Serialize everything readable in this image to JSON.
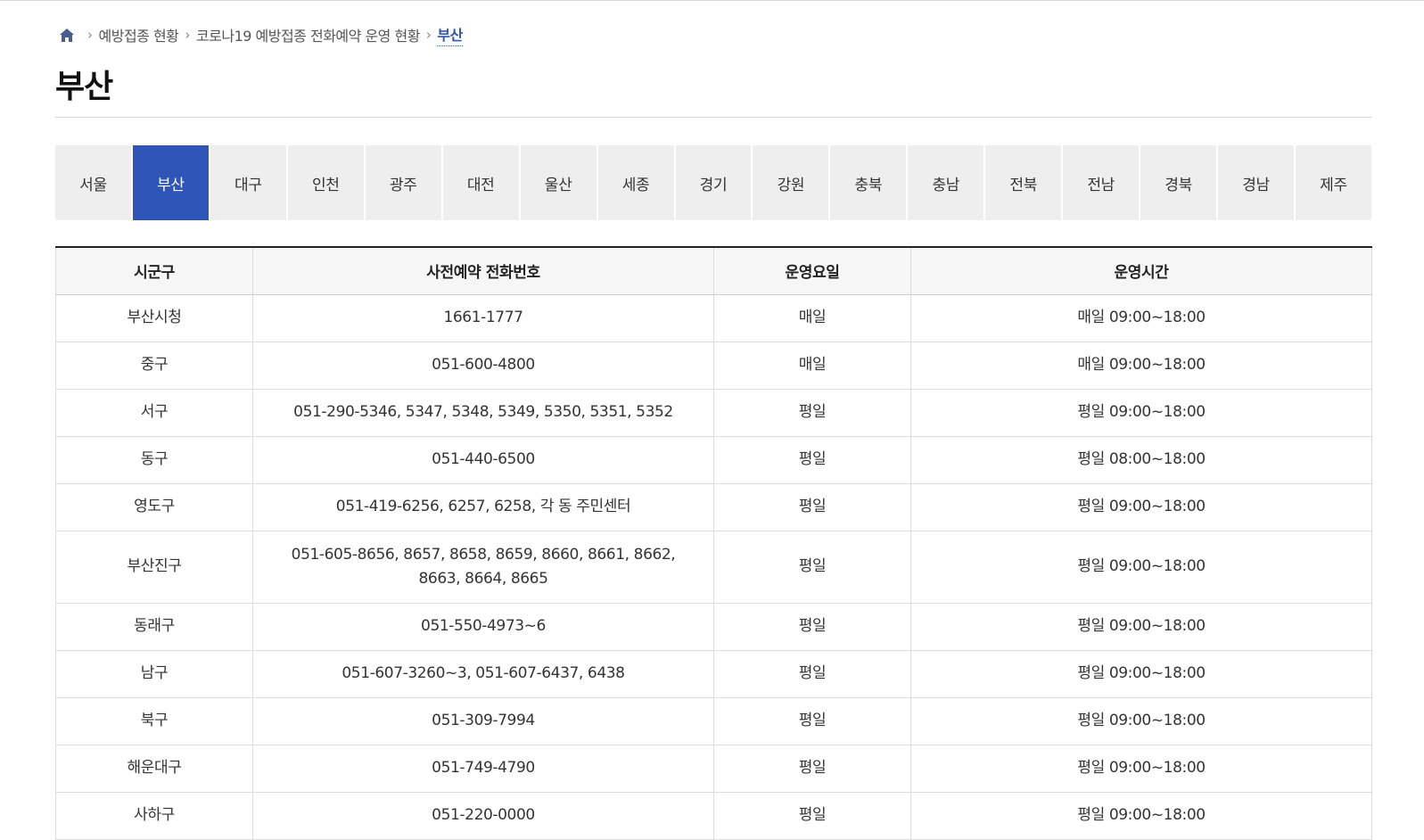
{
  "breadcrumb": {
    "items": [
      "예방접종 현황",
      "코로나19 예방접종 전화예약 운영 현황"
    ],
    "current": "부산"
  },
  "page_title": "부산",
  "tabs": [
    "서울",
    "부산",
    "대구",
    "인천",
    "광주",
    "대전",
    "울산",
    "세종",
    "경기",
    "강원",
    "충북",
    "충남",
    "전북",
    "전남",
    "경북",
    "경남",
    "제주"
  ],
  "active_tab_index": 1,
  "colors": {
    "accent": "#2f55b8",
    "tab_bg": "#eeeeee"
  },
  "table": {
    "headers": [
      "시군구",
      "사전예약 전화번호",
      "운영요일",
      "운영시간"
    ],
    "rows": [
      [
        "부산시청",
        "1661-1777",
        "매일",
        "매일 09:00~18:00"
      ],
      [
        "중구",
        "051-600-4800",
        "매일",
        "매일 09:00~18:00"
      ],
      [
        "서구",
        "051-290-5346, 5347, 5348, 5349, 5350, 5351, 5352",
        "평일",
        "평일 09:00~18:00"
      ],
      [
        "동구",
        "051-440-6500",
        "평일",
        "평일 08:00~18:00"
      ],
      [
        "영도구",
        "051-419-6256, 6257, 6258, 각 동 주민센터",
        "평일",
        "평일 09:00~18:00"
      ],
      [
        "부산진구",
        "051-605-8656, 8657, 8658, 8659, 8660, 8661, 8662, 8663, 8664, 8665",
        "평일",
        "평일 09:00~18:00"
      ],
      [
        "동래구",
        "051-550-4973~6",
        "평일",
        "평일 09:00~18:00"
      ],
      [
        "남구",
        "051-607-3260~3, 051-607-6437, 6438",
        "평일",
        "평일 09:00~18:00"
      ],
      [
        "북구",
        "051-309-7994",
        "평일",
        "평일 09:00~18:00"
      ],
      [
        "해운대구",
        "051-749-4790",
        "평일",
        "평일 09:00~18:00"
      ],
      [
        "사하구",
        "051-220-0000",
        "평일",
        "평일 09:00~18:00"
      ]
    ]
  }
}
